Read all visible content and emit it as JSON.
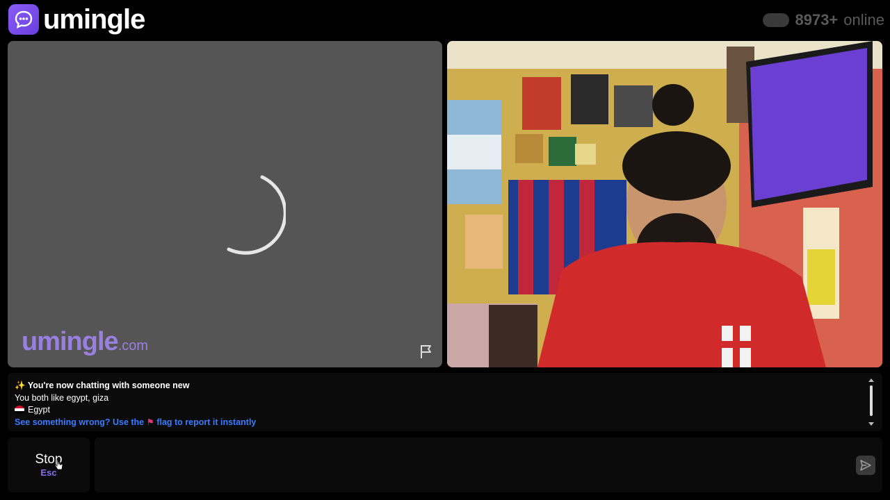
{
  "header": {
    "brand": "umingle",
    "online_count": "8973+",
    "online_label": "online"
  },
  "video_left": {
    "watermark_brand": "umingle",
    "watermark_suffix": ".com",
    "status": "loading"
  },
  "chat": {
    "line_new": "You're now chatting with someone new",
    "line_interests": "You both like egypt, giza",
    "country": "Egypt",
    "report_prefix": "See something wrong? Use the",
    "report_suffix": "flag to report it instantly"
  },
  "controls": {
    "stop_label": "Stop",
    "stop_key": "Esc",
    "message_placeholder": ""
  },
  "colors": {
    "accent": "#8a5cf6",
    "link": "#3b7bff"
  }
}
